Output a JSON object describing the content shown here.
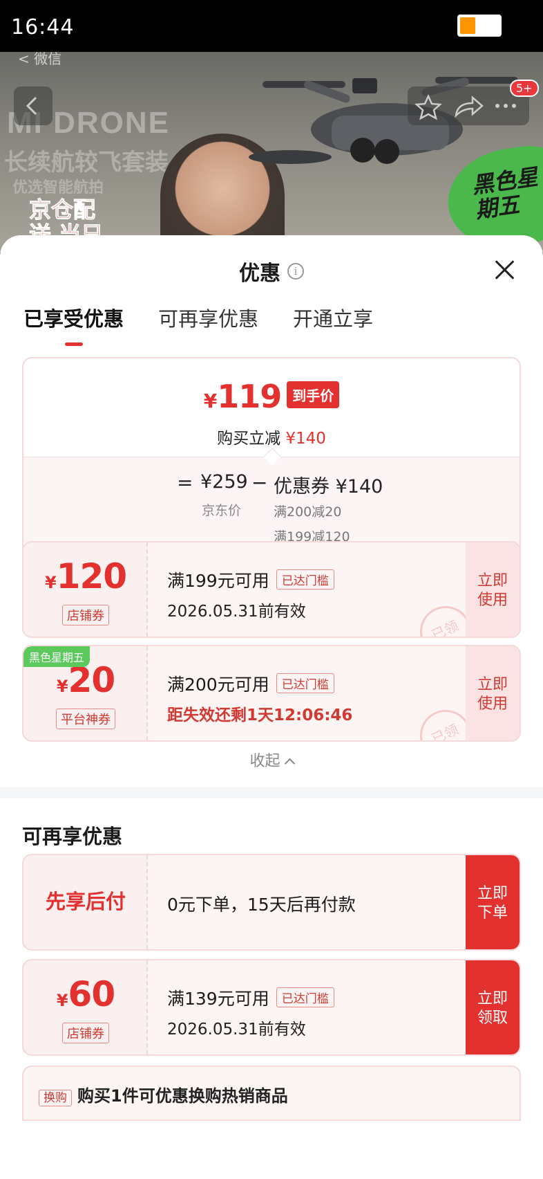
{
  "status_bar": {
    "time": "16:44"
  },
  "hero": {
    "back_label": "< 微信",
    "brand": "MI DRONE",
    "slogan1": "长续航较飞套装",
    "slogan2": "优选智能航拍",
    "delivery_tag": "京仓配送 当日偏日达",
    "promo_badge": "黑色星期五",
    "cart_badge": "5+"
  },
  "sheet": {
    "title": "优惠",
    "info_icon": "i",
    "tabs": [
      {
        "label": "已享受优惠",
        "active": true
      },
      {
        "label": "可再享优惠",
        "active": false
      },
      {
        "label": "开通立享",
        "active": false
      }
    ]
  },
  "summary": {
    "yen": "¥",
    "final_price": "119",
    "price_tag": "到手价",
    "reduce_label": "购买立减",
    "reduce_amount": "¥140",
    "equals": "=",
    "jd_price": "¥259",
    "minus": "−",
    "coupon_total": "优惠券 ¥140",
    "jd_price_label": "京东价",
    "conditions": [
      "满200减20",
      "满199减120"
    ]
  },
  "coupons": [
    {
      "yen": "¥",
      "amount": "120",
      "type": "店铺券",
      "condition": "满199元可用",
      "chip": "已达门槛",
      "validity": "2026.05.31前有效",
      "action_line1": "立即",
      "action_line2": "使用",
      "stamp": "已领"
    },
    {
      "corner": "黑色星期五",
      "yen": "¥",
      "amount": "20",
      "type": "平台神券",
      "condition": "满200元可用",
      "chip": "已达门槛",
      "validity": "距失效还剩1天12:06:46",
      "action_line1": "立即",
      "action_line2": "使用",
      "stamp": "已领"
    }
  ],
  "collapse_label": "收起",
  "more_section": {
    "title": "可再享优惠",
    "paylater": {
      "label": "先享后付",
      "description": "0元下单，15天后再付款",
      "action_line1": "立即",
      "action_line2": "下单"
    },
    "coupon": {
      "yen": "¥",
      "amount": "60",
      "type": "店铺券",
      "condition": "满139元可用",
      "chip": "已达门槛",
      "validity": "2026.05.31前有效",
      "action_line1": "立即",
      "action_line2": "领取"
    },
    "next_item": {
      "chip": "换购",
      "text": "购买1件可优惠换购热销商品"
    }
  },
  "colors": {
    "accent": "#e3312f",
    "promo_green": "#5bc95b"
  }
}
